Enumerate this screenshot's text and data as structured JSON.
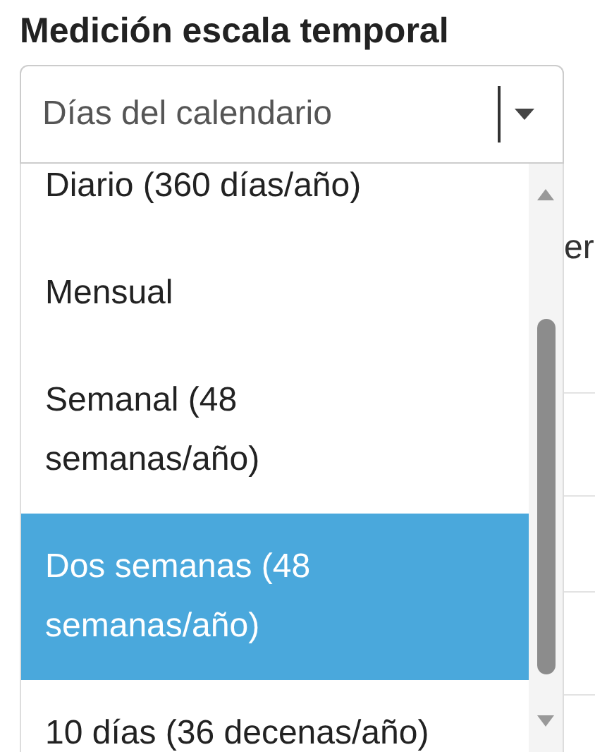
{
  "heading": "Medición escala temporal",
  "select": {
    "value": "Días del calendario",
    "expanded": true
  },
  "options": [
    {
      "label": "Diario (360 días/año)",
      "selected": false
    },
    {
      "label": "Mensual",
      "selected": false
    },
    {
      "label": "Semanal (48 semanas/año)",
      "selected": false
    },
    {
      "label": "Dos semanas (48 semanas/año)",
      "selected": true
    },
    {
      "label": "10 días (36 decenas/año)",
      "selected": false
    }
  ],
  "background_text": "er"
}
